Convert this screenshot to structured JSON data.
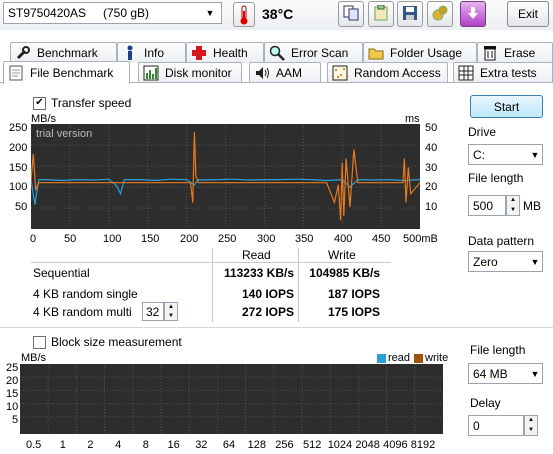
{
  "toolbar": {
    "drive_name": "ST9750420AS",
    "drive_size": "(750 gB)",
    "temperature": "38°C",
    "exit_label": "Exit"
  },
  "tabs_row1": [
    "Benchmark",
    "Info",
    "Health",
    "Error Scan",
    "Folder Usage",
    "Erase"
  ],
  "tabs_row2": [
    "File Benchmark",
    "Disk monitor",
    "AAM",
    "Random Access",
    "Extra tests"
  ],
  "top": {
    "transfer_speed_label": "Transfer speed",
    "transfer_speed_checked": true,
    "left_unit": "MB/s",
    "right_unit": "ms",
    "watermark": "trial version",
    "y_left_ticks": [
      "250",
      "200",
      "150",
      "100",
      "50"
    ],
    "y_right_ticks": [
      "50",
      "40",
      "30",
      "20",
      "10"
    ],
    "x_ticks": [
      "0",
      "50",
      "100",
      "150",
      "200",
      "250",
      "300",
      "350",
      "400",
      "450",
      "500mB"
    ]
  },
  "results": {
    "read_header": "Read",
    "write_header": "Write",
    "rows": [
      {
        "label": "Sequential",
        "read": "113233 KB/s",
        "write": "104985 KB/s"
      },
      {
        "label": "4 KB random single",
        "read": "140 IOPS",
        "write": "187 IOPS"
      },
      {
        "label": "4 KB random multi",
        "read": "272 IOPS",
        "write": "175 IOPS"
      }
    ],
    "multi_queue": "32"
  },
  "bottom": {
    "block_size_label": "Block size measurement",
    "block_size_checked": false,
    "unit": "MB/s",
    "legend_read": "read",
    "legend_write": "write",
    "y_ticks": [
      "25",
      "20",
      "15",
      "10",
      "5"
    ],
    "x_ticks": [
      "0.5",
      "1",
      "2",
      "4",
      "8",
      "16",
      "32",
      "64",
      "128",
      "256",
      "512",
      "1024",
      "2048",
      "4096",
      "8192"
    ]
  },
  "side": {
    "start_label": "Start",
    "drive_label": "Drive",
    "drive_value": "C:",
    "file_length_label": "File length",
    "file_length_value": "500",
    "file_length_unit": "MB",
    "data_pattern_label": "Data pattern",
    "data_pattern_value": "Zero",
    "file_length2_label": "File length",
    "file_length2_value": "64 MB",
    "delay_label": "Delay",
    "delay_value": "0"
  },
  "colors": {
    "read": "#2a9fd8",
    "write": "#e87a1c",
    "graph_bg": "#2d2d2d"
  },
  "chart_data": {
    "type": "line",
    "title": "",
    "xlabel": "",
    "ylabel": "MB/s",
    "xlim": [
      0,
      500
    ],
    "ylim": [
      0,
      250
    ],
    "y2lim": [
      0,
      50
    ],
    "series": [
      {
        "name": "Read",
        "x": [
          0,
          5,
          10,
          20,
          40,
          60,
          80,
          100,
          110,
          115,
          120,
          140,
          160,
          180,
          200,
          210,
          215,
          220,
          240,
          260,
          280,
          300,
          320,
          340,
          360,
          380,
          400,
          410,
          420,
          440,
          460,
          480,
          500
        ],
        "values": [
          112,
          55,
          112,
          112,
          110,
          112,
          111,
          113,
          98,
          80,
          112,
          112,
          110,
          113,
          112,
          100,
          112,
          111,
          112,
          113,
          111,
          112,
          112,
          113,
          112,
          110,
          112,
          95,
          112,
          111,
          112,
          110,
          112
        ]
      },
      {
        "name": "Write",
        "x": [
          0,
          3,
          6,
          10,
          205,
          208,
          210,
          212,
          215,
          380,
          390,
          395,
          398,
          400,
          402,
          405,
          410,
          415,
          420,
          478,
          480,
          482,
          485,
          488,
          500
        ],
        "values": [
          110,
          170,
          90,
          105,
          105,
          60,
          220,
          120,
          105,
          105,
          60,
          100,
          20,
          150,
          30,
          160,
          50,
          180,
          105,
          105,
          160,
          60,
          140,
          80,
          105
        ]
      }
    ]
  }
}
